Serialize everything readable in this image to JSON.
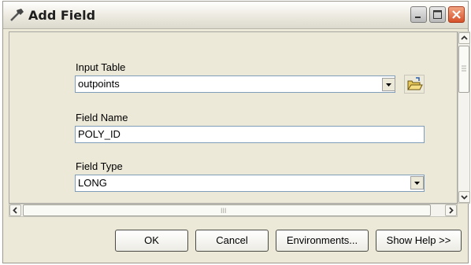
{
  "window": {
    "title": "Add Field"
  },
  "form": {
    "input_table": {
      "label": "Input Table",
      "value": "outpoints"
    },
    "field_name": {
      "label": "Field Name",
      "value": "POLY_ID"
    },
    "field_type": {
      "label": "Field Type",
      "value": "LONG"
    }
  },
  "scrollbar": {
    "grip": "III"
  },
  "buttons": {
    "ok": "OK",
    "cancel": "Cancel",
    "environments": "Environments...",
    "show_help": "Show Help >>"
  },
  "icons": {
    "app": "hammer-icon",
    "browse": "open-folder-icon"
  }
}
